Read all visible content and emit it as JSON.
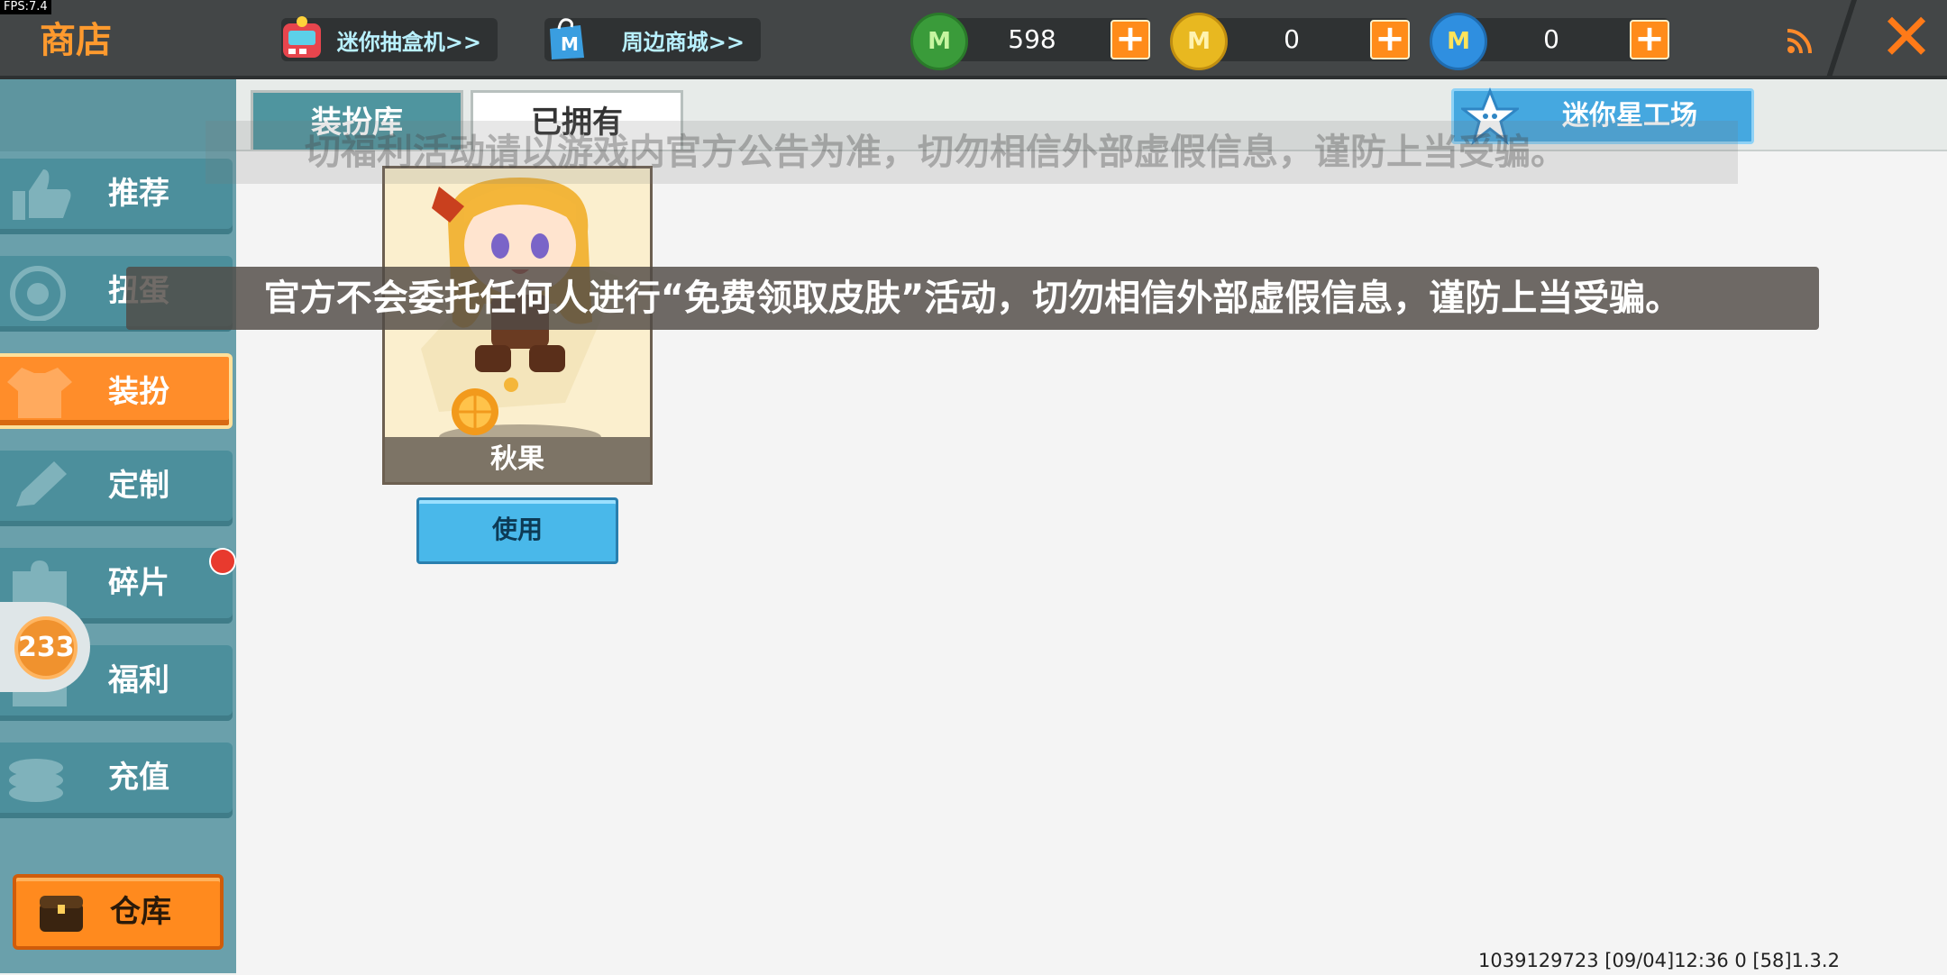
{
  "fps": "FPS:7.4",
  "header": {
    "title": "商店",
    "links": [
      {
        "label": "迷你抽盒机>>",
        "icon": "capsule-machine-icon"
      },
      {
        "label": "周边商城>>",
        "icon": "shopping-bag-icon"
      }
    ],
    "currencies": [
      {
        "name": "mini-bean",
        "value": "598",
        "color": "#3a9b3a"
      },
      {
        "name": "mini-coin",
        "value": "0",
        "color": "#e8b820"
      },
      {
        "name": "mini-point",
        "value": "0",
        "color": "#2f8fe0"
      }
    ]
  },
  "sidebar": {
    "items": [
      {
        "label": "推荐",
        "icon": "thumbs-up-icon"
      },
      {
        "label": "扭蛋",
        "icon": "gacha-icon"
      },
      {
        "label": "装扮",
        "icon": "shirt-icon",
        "active": true
      },
      {
        "label": "定制",
        "icon": "pencil-icon"
      },
      {
        "label": "碎片",
        "icon": "puzzle-icon"
      },
      {
        "label": "福利",
        "icon": "gift-icon"
      },
      {
        "label": "充值",
        "icon": "coins-icon"
      }
    ],
    "float_badge": "233",
    "warehouse_label": "仓库"
  },
  "tabs": [
    {
      "label": "装扮库",
      "active": false
    },
    {
      "label": "已拥有",
      "active": true
    }
  ],
  "star_workshop_label": "迷你星工场",
  "card": {
    "name": "秋果",
    "use_label": "使用"
  },
  "notices": {
    "back": "切福利活动请以游戏内官方公告为准，切勿相信外部虚假信息，谨防上当受骗。",
    "front": "官方不会委托任何人进行“免费领取皮肤”活动，切勿相信外部虚假信息，谨防上当受骗。"
  },
  "footer": "1039129723    [09/04]12:36 0 [58]1.3.2"
}
